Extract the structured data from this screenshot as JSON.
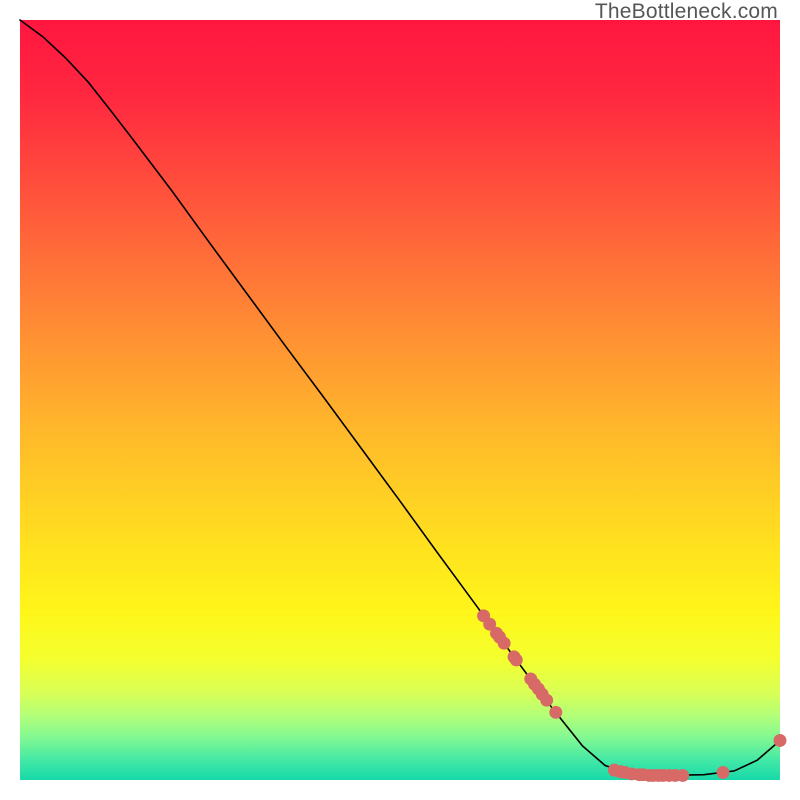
{
  "watermark": "TheBottleneck.com",
  "colors": {
    "gradient_stops": [
      {
        "offset": 0.0,
        "color": "#ff163f"
      },
      {
        "offset": 0.1,
        "color": "#ff2840"
      },
      {
        "offset": 0.25,
        "color": "#ff593b"
      },
      {
        "offset": 0.4,
        "color": "#ff8b34"
      },
      {
        "offset": 0.55,
        "color": "#ffbb2a"
      },
      {
        "offset": 0.7,
        "color": "#ffe31e"
      },
      {
        "offset": 0.78,
        "color": "#fff61a"
      },
      {
        "offset": 0.84,
        "color": "#f4ff2e"
      },
      {
        "offset": 0.885,
        "color": "#d9ff56"
      },
      {
        "offset": 0.915,
        "color": "#b3ff78"
      },
      {
        "offset": 0.945,
        "color": "#80f893"
      },
      {
        "offset": 0.975,
        "color": "#41e8a6"
      },
      {
        "offset": 1.0,
        "color": "#17d9a9"
      }
    ],
    "curve": "#000000",
    "markers": "#d76a66",
    "markers_stroke": "#d76a66"
  },
  "chart_data": {
    "type": "line",
    "title": "",
    "xlabel": "",
    "ylabel": "",
    "xlim": [
      0,
      100
    ],
    "ylim": [
      0,
      100
    ],
    "curve": [
      {
        "x": 0.0,
        "y": 100.0
      },
      {
        "x": 3.0,
        "y": 97.8
      },
      {
        "x": 6.0,
        "y": 95.0
      },
      {
        "x": 9.0,
        "y": 91.8
      },
      {
        "x": 12.0,
        "y": 88.0
      },
      {
        "x": 15.0,
        "y": 84.1
      },
      {
        "x": 20.0,
        "y": 77.5
      },
      {
        "x": 25.0,
        "y": 70.6
      },
      {
        "x": 30.0,
        "y": 63.8
      },
      {
        "x": 35.0,
        "y": 57.0
      },
      {
        "x": 40.0,
        "y": 50.3
      },
      {
        "x": 45.0,
        "y": 43.5
      },
      {
        "x": 50.0,
        "y": 36.7
      },
      {
        "x": 55.0,
        "y": 29.8
      },
      {
        "x": 60.0,
        "y": 23.0
      },
      {
        "x": 65.0,
        "y": 16.2
      },
      {
        "x": 70.0,
        "y": 9.5
      },
      {
        "x": 74.0,
        "y": 4.5
      },
      {
        "x": 77.0,
        "y": 1.9
      },
      {
        "x": 80.0,
        "y": 0.9
      },
      {
        "x": 85.0,
        "y": 0.6
      },
      {
        "x": 90.0,
        "y": 0.7
      },
      {
        "x": 94.0,
        "y": 1.2
      },
      {
        "x": 97.0,
        "y": 2.6
      },
      {
        "x": 100.0,
        "y": 5.2
      }
    ],
    "markers": [
      {
        "x": 61.0,
        "y": 21.6
      },
      {
        "x": 61.8,
        "y": 20.5
      },
      {
        "x": 62.7,
        "y": 19.3
      },
      {
        "x": 63.1,
        "y": 18.8
      },
      {
        "x": 63.7,
        "y": 18.0
      },
      {
        "x": 65.0,
        "y": 16.2
      },
      {
        "x": 65.3,
        "y": 15.8
      },
      {
        "x": 67.2,
        "y": 13.3
      },
      {
        "x": 67.7,
        "y": 12.6
      },
      {
        "x": 68.2,
        "y": 12.0
      },
      {
        "x": 68.7,
        "y": 11.3
      },
      {
        "x": 69.3,
        "y": 10.5
      },
      {
        "x": 70.5,
        "y": 8.9
      },
      {
        "x": 78.2,
        "y": 1.3
      },
      {
        "x": 79.0,
        "y": 1.1
      },
      {
        "x": 79.6,
        "y": 1.0
      },
      {
        "x": 80.5,
        "y": 0.8
      },
      {
        "x": 81.5,
        "y": 0.7
      },
      {
        "x": 82.0,
        "y": 0.7
      },
      {
        "x": 82.8,
        "y": 0.6
      },
      {
        "x": 83.3,
        "y": 0.6
      },
      {
        "x": 84.0,
        "y": 0.6
      },
      {
        "x": 84.6,
        "y": 0.6
      },
      {
        "x": 85.4,
        "y": 0.6
      },
      {
        "x": 86.2,
        "y": 0.6
      },
      {
        "x": 87.2,
        "y": 0.6
      },
      {
        "x": 92.5,
        "y": 1.0
      },
      {
        "x": 100.0,
        "y": 5.2
      }
    ]
  }
}
